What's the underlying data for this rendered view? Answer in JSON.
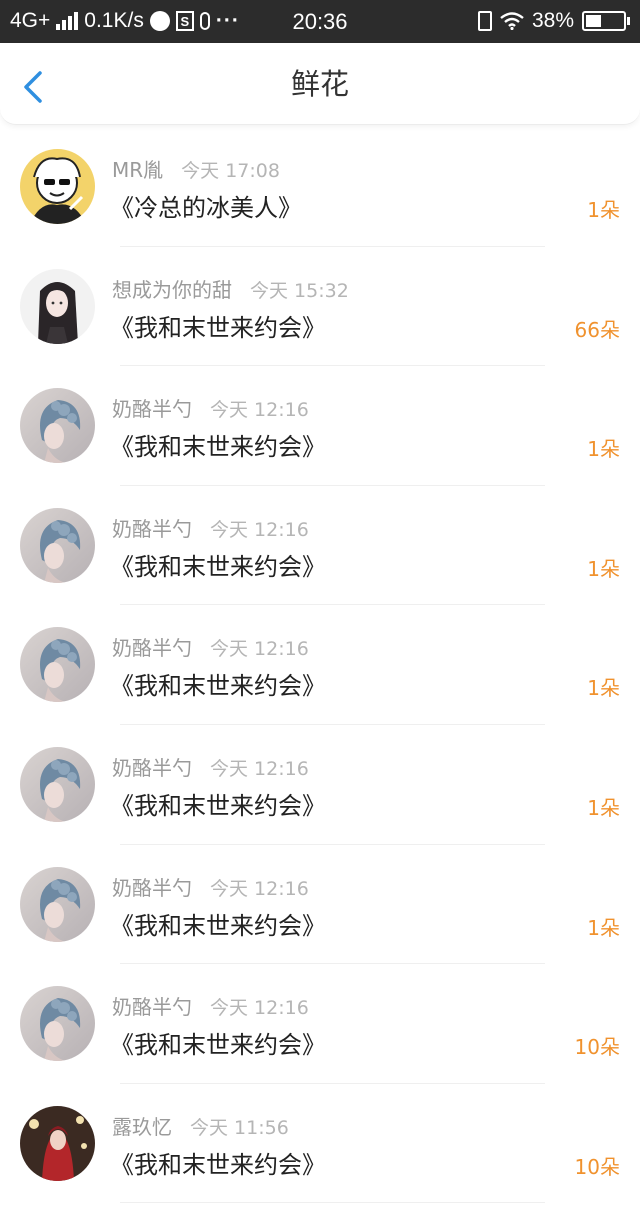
{
  "status_bar": {
    "network": "4G+",
    "speed": "0.1K/s",
    "time": "20:36",
    "battery": "38%",
    "battery_level": 0.38,
    "icons": [
      "signal-icon",
      "messenger-icon",
      "s-app-icon",
      "mic-icon",
      "more-icon",
      "vibrate-icon",
      "wifi-icon",
      "battery-icon"
    ]
  },
  "nav": {
    "title": "鲜花",
    "back_icon": "chevron-left-icon",
    "accent_color": "#2f8fe0"
  },
  "colors": {
    "count": "#f0922e",
    "name": "#9a9a9a",
    "time": "#b5b5b5"
  },
  "records": [
    {
      "name": "MR胤",
      "time": "今天 17:08",
      "book": "《冷总的冰美人》",
      "count": "1朵",
      "avatar": "avatar-mr"
    },
    {
      "name": "想成为你的甜",
      "time": "今天 15:32",
      "book": "《我和末世来约会》",
      "count": "66朵",
      "avatar": "avatar-girl-dark-hair"
    },
    {
      "name": "奶酪半勺",
      "time": "今天 12:16",
      "book": "《我和末世来约会》",
      "count": "1朵",
      "avatar": "avatar-girl-blue-hair"
    },
    {
      "name": "奶酪半勺",
      "time": "今天 12:16",
      "book": "《我和末世来约会》",
      "count": "1朵",
      "avatar": "avatar-girl-blue-hair"
    },
    {
      "name": "奶酪半勺",
      "time": "今天 12:16",
      "book": "《我和末世来约会》",
      "count": "1朵",
      "avatar": "avatar-girl-blue-hair"
    },
    {
      "name": "奶酪半勺",
      "time": "今天 12:16",
      "book": "《我和末世来约会》",
      "count": "1朵",
      "avatar": "avatar-girl-blue-hair"
    },
    {
      "name": "奶酪半勺",
      "time": "今天 12:16",
      "book": "《我和末世来约会》",
      "count": "1朵",
      "avatar": "avatar-girl-blue-hair"
    },
    {
      "name": "奶酪半勺",
      "time": "今天 12:16",
      "book": "《我和末世来约会》",
      "count": "10朵",
      "avatar": "avatar-girl-blue-hair"
    },
    {
      "name": "露玖忆",
      "time": "今天 11:56",
      "book": "《我和末世来约会》",
      "count": "10朵",
      "avatar": "avatar-girl-red"
    }
  ]
}
